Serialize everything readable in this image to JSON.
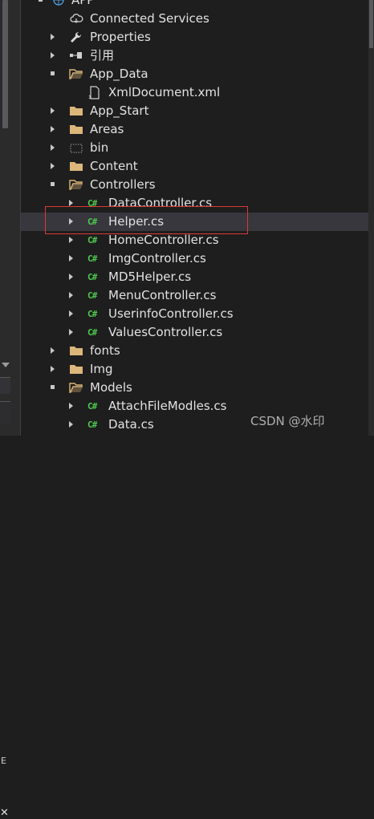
{
  "tree": {
    "items": [
      {
        "label": "APP",
        "icon": "globe-icon",
        "state": "expanded",
        "name": "project-app"
      },
      {
        "label": "Connected Services",
        "icon": "cloud-icon",
        "state": "none",
        "name": "connected-services"
      },
      {
        "label": "Properties",
        "icon": "wrench-icon",
        "state": "collapsed",
        "name": "properties"
      },
      {
        "label": "引用",
        "icon": "references-icon",
        "state": "collapsed",
        "name": "references"
      },
      {
        "label": "App_Data",
        "icon": "folder-open-icon",
        "state": "expanded",
        "name": "app-data"
      },
      {
        "label": "XmlDocument.xml",
        "icon": "xml-file-icon",
        "state": "none",
        "name": "xmldocument-xml"
      },
      {
        "label": "App_Start",
        "icon": "folder-icon",
        "state": "collapsed",
        "name": "app-start"
      },
      {
        "label": "Areas",
        "icon": "folder-icon",
        "state": "collapsed",
        "name": "areas"
      },
      {
        "label": "bin",
        "icon": "folder-dashed-icon",
        "state": "collapsed",
        "name": "bin"
      },
      {
        "label": "Content",
        "icon": "folder-icon",
        "state": "collapsed",
        "name": "content"
      },
      {
        "label": "Controllers",
        "icon": "folder-open-icon",
        "state": "expanded",
        "name": "controllers"
      },
      {
        "label": "DataController.cs",
        "icon": "csharp-file-icon",
        "state": "collapsed",
        "name": "datacontroller-cs"
      },
      {
        "label": "Helper.cs",
        "icon": "csharp-file-icon",
        "state": "collapsed",
        "name": "helper-cs"
      },
      {
        "label": "HomeController.cs",
        "icon": "csharp-file-icon",
        "state": "collapsed",
        "name": "homecontroller-cs"
      },
      {
        "label": "ImgController.cs",
        "icon": "csharp-file-icon",
        "state": "collapsed",
        "name": "imgcontroller-cs"
      },
      {
        "label": "MD5Helper.cs",
        "icon": "csharp-file-icon",
        "state": "collapsed",
        "name": "md5helper-cs"
      },
      {
        "label": "MenuController.cs",
        "icon": "csharp-file-icon",
        "state": "collapsed",
        "name": "menucontroller-cs"
      },
      {
        "label": "UserinfoController.cs",
        "icon": "csharp-file-icon",
        "state": "collapsed",
        "name": "userinfocontroller-cs"
      },
      {
        "label": "ValuesController.cs",
        "icon": "csharp-file-icon",
        "state": "collapsed",
        "name": "valuescontroller-cs"
      },
      {
        "label": "fonts",
        "icon": "folder-icon",
        "state": "collapsed",
        "name": "fonts"
      },
      {
        "label": "Img",
        "icon": "folder-icon",
        "state": "collapsed",
        "name": "img"
      },
      {
        "label": "Models",
        "icon": "folder-open-icon",
        "state": "expanded",
        "name": "models"
      },
      {
        "label": "AttachFileModles.cs",
        "icon": "csharp-file-icon",
        "state": "collapsed",
        "name": "attachfilemodles-cs"
      },
      {
        "label": "Data.cs",
        "icon": "csharp-file-icon",
        "state": "collapsed",
        "name": "data-cs"
      }
    ],
    "csharp_badge": "C#"
  },
  "left_rail": {
    "partial_text": "E",
    "close_glyph": "✕"
  },
  "watermark": "CSDN @水印",
  "colors": {
    "folder": "#dcb67a",
    "csharp": "#4ec94e",
    "selection": "#37373d",
    "highlight_box": "#d93a3a"
  }
}
